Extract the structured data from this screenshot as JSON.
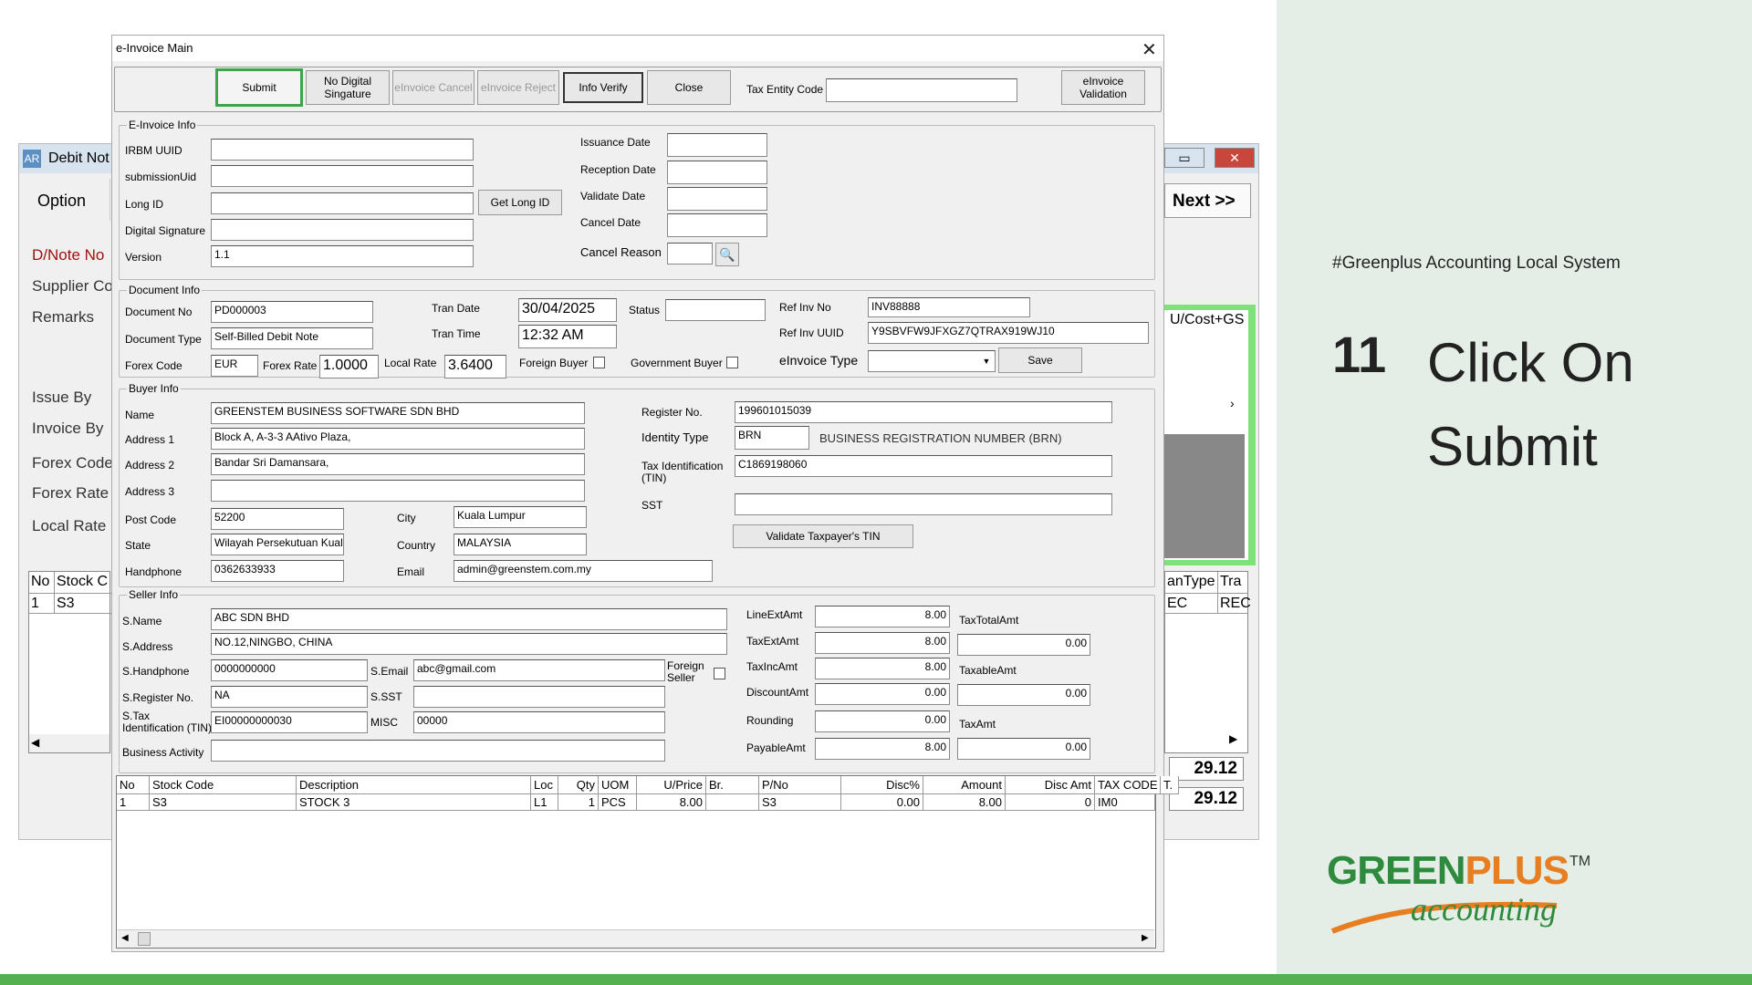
{
  "slide": {
    "hashtag": "#Greenplus Accounting Local System",
    "step_number": "11",
    "step_text_line1": "Click On",
    "step_text_line2": "Submit",
    "logo_main_a": "GREEN",
    "logo_main_b": "PLUS",
    "logo_tm": "TM",
    "logo_sub": "accounting"
  },
  "bg_window": {
    "title": "Debit Not",
    "icon_text": "AR",
    "menu": "Option",
    "next": "Next >>",
    "labels": [
      "D/Note No",
      "Supplier Co",
      "Remarks",
      "Issue By",
      "Invoice By",
      "Forex Code",
      "Forex Rate",
      "Local Rate"
    ],
    "col_right": "U/Cost+GS",
    "grid_left_headers": [
      "No",
      "Stock C"
    ],
    "grid_left_row": [
      "1",
      "S3"
    ],
    "grid_right_headers": [
      "anType",
      "Tra"
    ],
    "grid_right_row": [
      "EC",
      "REC"
    ],
    "total1": "29.12",
    "total2": "29.12"
  },
  "dialog": {
    "title": "e-Invoice Main",
    "toolbar": {
      "submit": "Submit",
      "no_digital_sig": "No Digital Singature",
      "einvoice_cancel": "eInvoice Cancel",
      "einvoice_reject": "eInvoice Reject",
      "info_verify": "Info Verify",
      "close": "Close",
      "tax_entity_code_label": "Tax Entity Code",
      "tax_entity_code_value": "",
      "einvoice_validation": "eInvoice Validation"
    },
    "einvoice_info": {
      "group": "E-Invoice Info",
      "irbm_uuid_label": "IRBM UUID",
      "irbm_uuid": "",
      "submission_uid_label": "submissionUid",
      "submission_uid": "",
      "long_id_label": "Long ID",
      "long_id": "",
      "get_long_id": "Get Long ID",
      "digital_signature_label": "Digital Signature",
      "digital_signature": "",
      "version_label": "Version",
      "version": "1.1",
      "issuance_date_label": "Issuance Date",
      "issuance_date": "",
      "reception_date_label": "Reception Date",
      "reception_date": "",
      "validate_date_label": "Validate Date",
      "validate_date": "",
      "cancel_date_label": "Cancel Date",
      "cancel_date": "",
      "cancel_reason_label": "Cancel Reason",
      "cancel_reason": ""
    },
    "document_info": {
      "group": "Document Info",
      "document_no_label": "Document No",
      "document_no": "PD000003",
      "document_type_label": "Document Type",
      "document_type": "Self-Billed Debit Note",
      "forex_code_label": "Forex Code",
      "forex_code": "EUR",
      "forex_rate_label": "Forex Rate",
      "forex_rate": "1.0000",
      "local_rate_label": "Local Rate",
      "local_rate": "3.6400",
      "tran_date_label": "Tran Date",
      "tran_date": "30/04/2025",
      "tran_time_label": "Tran Time",
      "tran_time": "12:32 AM",
      "status_label": "Status",
      "status": "",
      "foreign_buyer_label": "Foreign Buyer",
      "government_buyer_label": "Government Buyer",
      "ref_inv_no_label": "Ref Inv No",
      "ref_inv_no": "INV88888",
      "ref_inv_uuid_label": "Ref Inv UUID",
      "ref_inv_uuid": "Y9SBVFW9JFXGZ7QTRAX919WJ10",
      "einvoice_type_label": "eInvoice Type",
      "einvoice_type": "",
      "save": "Save"
    },
    "buyer_info": {
      "group": "Buyer Info",
      "name_label": "Name",
      "name": "GREENSTEM BUSINESS SOFTWARE SDN BHD",
      "address1_label": "Address 1",
      "address1": "Block A, A-3-3 AAtivo Plaza,",
      "address2_label": "Address 2",
      "address2": "Bandar Sri Damansara,",
      "address3_label": "Address 3",
      "address3": "",
      "post_code_label": "Post Code",
      "post_code": "52200",
      "state_label": "State",
      "state": "Wilayah Persekutuan Kuala Lumpur",
      "handphone_label": "Handphone",
      "handphone": "0362633933",
      "city_label": "City",
      "city": "Kuala Lumpur",
      "country_label": "Country",
      "country": "MALAYSIA",
      "email_label": "Email",
      "email": "admin@greenstem.com.my",
      "register_no_label": "Register No.",
      "register_no": "199601015039",
      "identity_type_label": "Identity Type",
      "identity_type": "BRN",
      "identity_type_desc": "BUSINESS REGISTRATION NUMBER (BRN)",
      "tin_label_1": "Tax Identification",
      "tin_label_2": "(TIN)",
      "tin": "C1869198060",
      "sst_label": "SST",
      "sst": "",
      "validate_tin": "Validate Taxpayer's TIN"
    },
    "seller_info": {
      "group": "Seller Info",
      "name_label": "S.Name",
      "name": "ABC SDN BHD",
      "address_label": "S.Address",
      "address": "NO.12,NINGBO, CHINA",
      "handphone_label": "S.Handphone",
      "handphone": "0000000000",
      "email_label": "S.Email",
      "email": "abc@gmail.com",
      "foreign_seller_label_1": "Foreign",
      "foreign_seller_label_2": "Seller",
      "register_no_label": "S.Register No.",
      "register_no": "NA",
      "sst_label": "S.SST",
      "sst": "",
      "tin_label_1": "S.Tax",
      "tin_label_2": "Identification (TIN)",
      "tin": "EI00000000030",
      "misc_label": "MISC",
      "misc": "00000",
      "business_activity_label": "Business Activity",
      "business_activity": ""
    },
    "amounts": {
      "line_ext_amt_label": "LineExtAmt",
      "line_ext_amt": "8.00",
      "tax_ext_amt_label": "TaxExtAmt",
      "tax_ext_amt": "8.00",
      "tax_inc_amt_label": "TaxIncAmt",
      "tax_inc_amt": "8.00",
      "discount_amt_label": "DiscountAmt",
      "discount_amt": "0.00",
      "rounding_label": "Rounding",
      "rounding": "0.00",
      "payable_amt_label": "PayableAmt",
      "payable_amt": "8.00",
      "tax_total_amt_label": "TaxTotalAmt",
      "tax_total_amt": "0.00",
      "taxable_amt_label": "TaxableAmt",
      "taxable_amt": "0.00",
      "tax_amt_label": "TaxAmt",
      "tax_amt": "0.00"
    },
    "items_grid": {
      "headers": [
        "No",
        "Stock Code",
        "Description",
        "Loc",
        "Qty",
        "UOM",
        "U/Price",
        "Br.",
        "P/No",
        "Disc%",
        "Amount",
        "Disc Amt",
        "TAX CODE",
        "T."
      ],
      "rows": [
        [
          "1",
          "S3",
          "STOCK 3",
          "L1",
          "1",
          "PCS",
          "8.00",
          "",
          "S3",
          "0.00",
          "8.00",
          "0",
          "IM0",
          ""
        ]
      ]
    }
  }
}
